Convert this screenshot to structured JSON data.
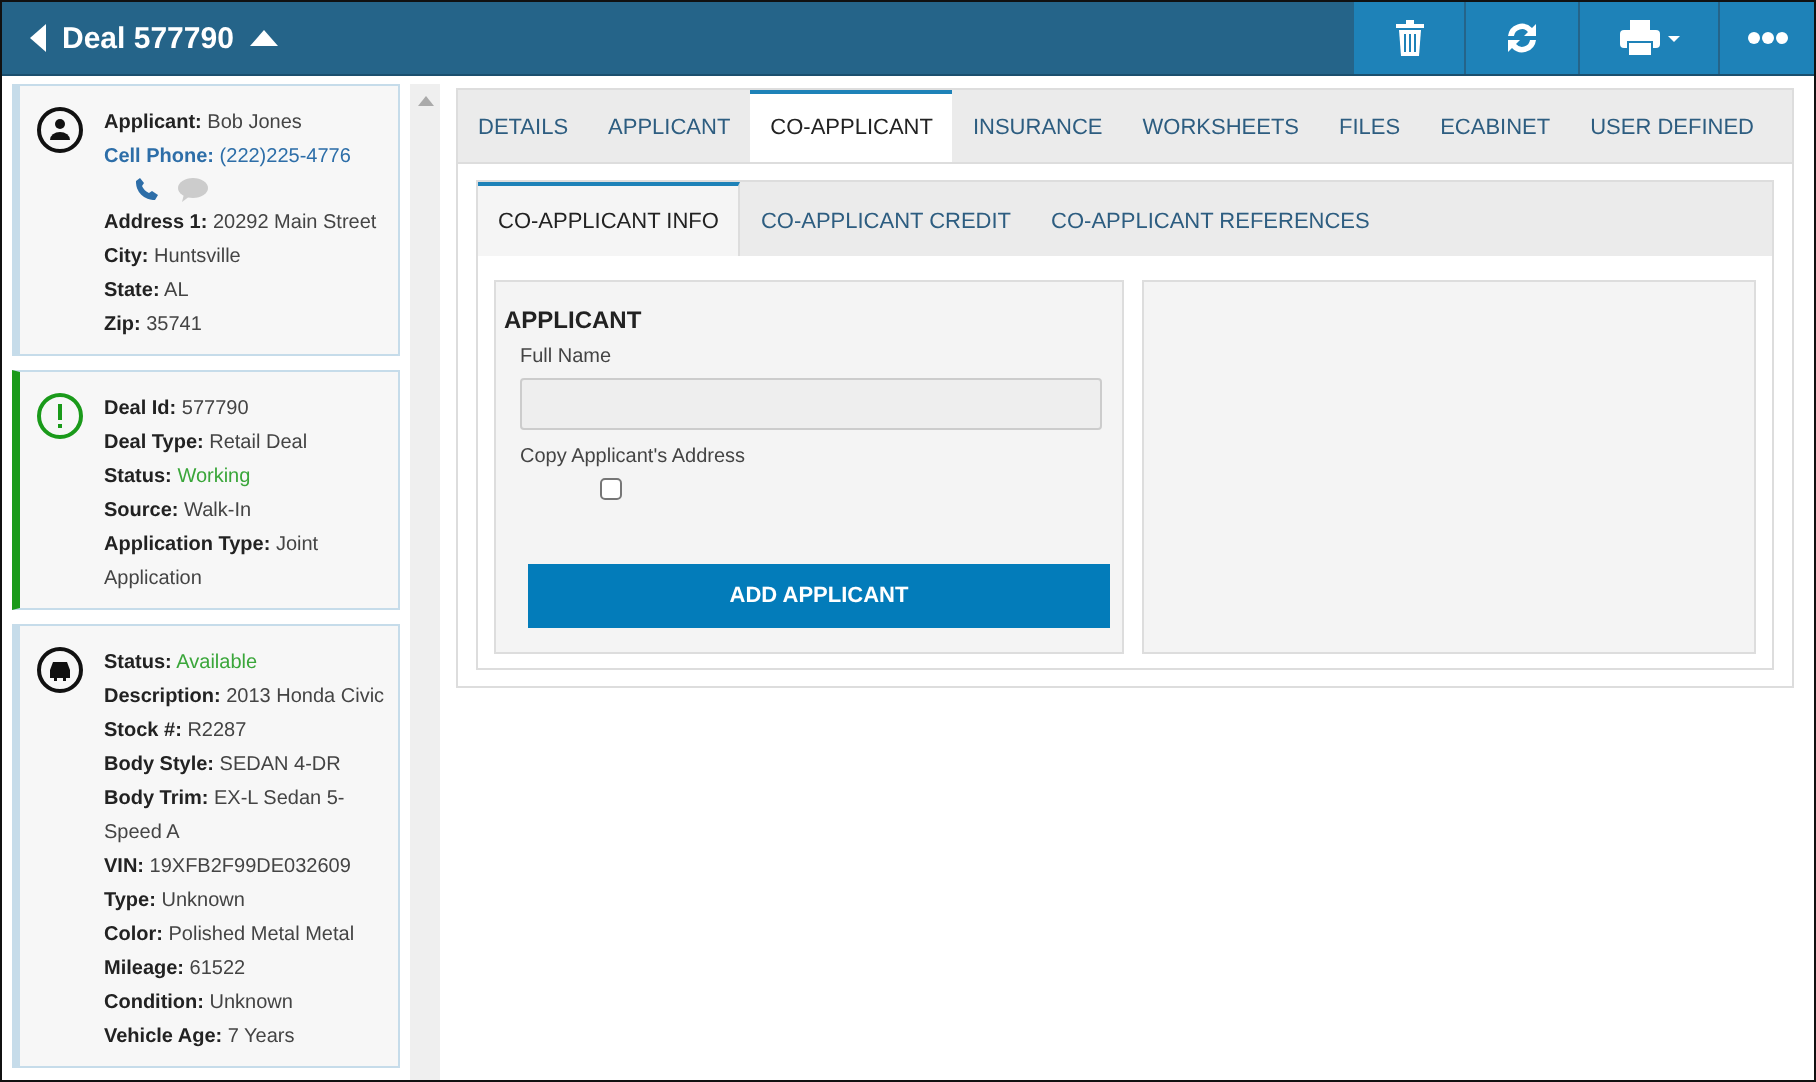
{
  "header": {
    "title": "Deal 577790",
    "actions": [
      {
        "kind": "delete"
      },
      {
        "kind": "refresh"
      },
      {
        "kind": "print"
      },
      {
        "kind": "more"
      }
    ]
  },
  "cards": [
    {
      "kind": "person",
      "color": "#c6dcea",
      "fields": [
        {
          "label": "Applicant:",
          "value": "Bob Jones",
          "kind": "plain"
        },
        {
          "label": "Cell Phone:",
          "value": "(222)225-4776",
          "kind": "phone"
        },
        {
          "label": "Address 1:",
          "value": "20292 Main Street",
          "kind": "plain"
        },
        {
          "label": "City:",
          "value": "Huntsville",
          "kind": "plain"
        },
        {
          "label": "State:",
          "value": "AL",
          "kind": "plain"
        },
        {
          "label": "Zip:",
          "value": "35741",
          "kind": "plain"
        }
      ]
    },
    {
      "kind": "alert",
      "color": "#1a9a1a",
      "fields": [
        {
          "label": "Deal Id:",
          "value": "577790",
          "kind": "plain"
        },
        {
          "label": "Deal Type:",
          "value": "Retail Deal",
          "kind": "plain"
        },
        {
          "label": "Status:",
          "value": "Working",
          "kind": "status"
        },
        {
          "label": "Source:",
          "value": "Walk-In",
          "kind": "plain"
        },
        {
          "label": "Application Type:",
          "value": "Joint Application",
          "kind": "plain"
        }
      ]
    },
    {
      "kind": "car",
      "color": "#c6dcea",
      "fields": [
        {
          "label": "Status:",
          "value": "Available",
          "kind": "status"
        },
        {
          "label": "Description:",
          "value": "2013 Honda Civic",
          "kind": "plain"
        },
        {
          "label": "Stock #:",
          "value": "R2287",
          "kind": "plain"
        },
        {
          "label": "Body Style:",
          "value": "SEDAN 4-DR",
          "kind": "plain"
        },
        {
          "label": "Body Trim:",
          "value": "EX-L Sedan 5-Speed A",
          "kind": "plain"
        },
        {
          "label": "VIN:",
          "value": "19XFB2F99DE032609",
          "kind": "plain"
        },
        {
          "label": "Type:",
          "value": "Unknown",
          "kind": "plain"
        },
        {
          "label": "Color:",
          "value": "Polished Metal Metal",
          "kind": "plain"
        },
        {
          "label": "Mileage:",
          "value": "61522",
          "kind": "plain"
        },
        {
          "label": "Condition:",
          "value": "Unknown",
          "kind": "plain"
        },
        {
          "label": "Vehicle Age:",
          "value": "7 Years",
          "kind": "plain"
        }
      ]
    }
  ],
  "tabs": [
    {
      "label": "DETAILS",
      "selected": false
    },
    {
      "label": "APPLICANT",
      "selected": false
    },
    {
      "label": "CO-APPLICANT",
      "selected": true
    },
    {
      "label": "INSURANCE",
      "selected": false
    },
    {
      "label": "WORKSHEETS",
      "selected": false
    },
    {
      "label": "FILES",
      "selected": false
    },
    {
      "label": "ECABINET",
      "selected": false
    },
    {
      "label": "USER DEFINED",
      "selected": false
    }
  ],
  "subtabs": [
    {
      "label": "CO-APPLICANT INFO",
      "selected": true
    },
    {
      "label": "CO-APPLICANT CREDIT",
      "selected": false
    },
    {
      "label": "CO-APPLICANT REFERENCES",
      "selected": false
    }
  ],
  "form": {
    "title": "APPLICANT",
    "full_name_label": "Full Name",
    "copy_label": "Copy Applicant's Address",
    "copy_checked": false,
    "button": "ADD APPLICANT"
  }
}
